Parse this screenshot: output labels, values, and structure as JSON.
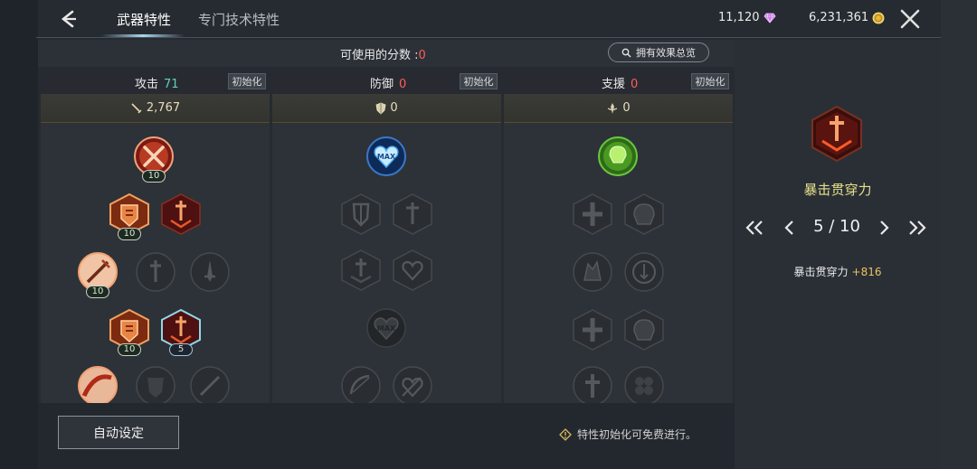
{
  "header": {
    "tabs": [
      {
        "label": "武器特性",
        "active": true
      },
      {
        "label": "专门技术特性",
        "active": false
      }
    ],
    "currency": {
      "gem": {
        "value": "11,120",
        "icon": "gem-icon",
        "color": "#d27bf0"
      },
      "gold": {
        "value": "6,231,361",
        "icon": "gold-coin-icon",
        "color": "#e7b93a"
      }
    }
  },
  "points": {
    "label": "可使用的分数 :",
    "value": "0"
  },
  "summary_button": {
    "label": "拥有效果总览",
    "icon": "search-icon"
  },
  "columns": [
    {
      "key": "attack",
      "title": "攻击",
      "points": "71",
      "reset_label": "初始化",
      "stat_icon": "sword-icon",
      "stat_value": "2,767"
    },
    {
      "key": "defense",
      "title": "防御",
      "points": "0",
      "reset_label": "初始化",
      "stat_icon": "shield-icon",
      "stat_value": "0"
    },
    {
      "key": "support",
      "title": "支援",
      "points": "0",
      "reset_label": "初始化",
      "stat_icon": "support-icon",
      "stat_value": "0"
    }
  ],
  "skills": {
    "attack": [
      {
        "icon": "crossed-swords-icon",
        "level": "10"
      },
      {
        "icon": "shield-fist-icon",
        "level": "10"
      },
      {
        "icon": "critical-sword-icon",
        "level": ""
      },
      {
        "icon": "sword-slash-icon",
        "level": "10"
      },
      {
        "icon": "locked-sword-icon",
        "level": ""
      },
      {
        "icon": "locked-dagger-icon",
        "level": ""
      },
      {
        "icon": "shield-fist-icon",
        "level": "10"
      },
      {
        "icon": "critical-sword-icon",
        "level": "5"
      },
      {
        "icon": "slash-arc-icon",
        "level": ""
      },
      {
        "icon": "locked-mask-icon",
        "level": ""
      },
      {
        "icon": "locked-blade-icon",
        "level": ""
      }
    ],
    "defense": [
      {
        "icon": "max-heart-icon",
        "label": "MAX"
      },
      {
        "icon": "locked-shield-icon"
      },
      {
        "icon": "locked-sword-down-icon"
      },
      {
        "icon": "locked-burst-icon"
      },
      {
        "icon": "locked-cross-heart-icon"
      },
      {
        "icon": "locked-max-heart-icon",
        "label": "MAX"
      },
      {
        "icon": "locked-bow-icon"
      },
      {
        "icon": "locked-heart-sword-icon"
      }
    ],
    "support": [
      {
        "icon": "green-potion-icon"
      },
      {
        "icon": "locked-cross-icon"
      },
      {
        "icon": "locked-brain-icon"
      },
      {
        "icon": "locked-dragon-icon"
      },
      {
        "icon": "locked-spiral-icon"
      },
      {
        "icon": "locked-cross-icon"
      },
      {
        "icon": "locked-brain-icon"
      },
      {
        "icon": "locked-cross-plain-icon"
      },
      {
        "icon": "locked-clover-icon"
      }
    ]
  },
  "detail": {
    "name": "暴击贯穿力",
    "icon": "critical-sword-icon",
    "page": "5 / 10",
    "effect_label": "暴击贯穿力",
    "effect_value": "+816"
  },
  "bottom": {
    "auto_button": "自动设定",
    "note": "特性初始化可免费进行。"
  },
  "colors": {
    "accent_green": "#5fd3b9",
    "accent_red": "#ff5b5b",
    "accent_yellow": "#e6e08a",
    "effect_value": "#f0c060"
  }
}
